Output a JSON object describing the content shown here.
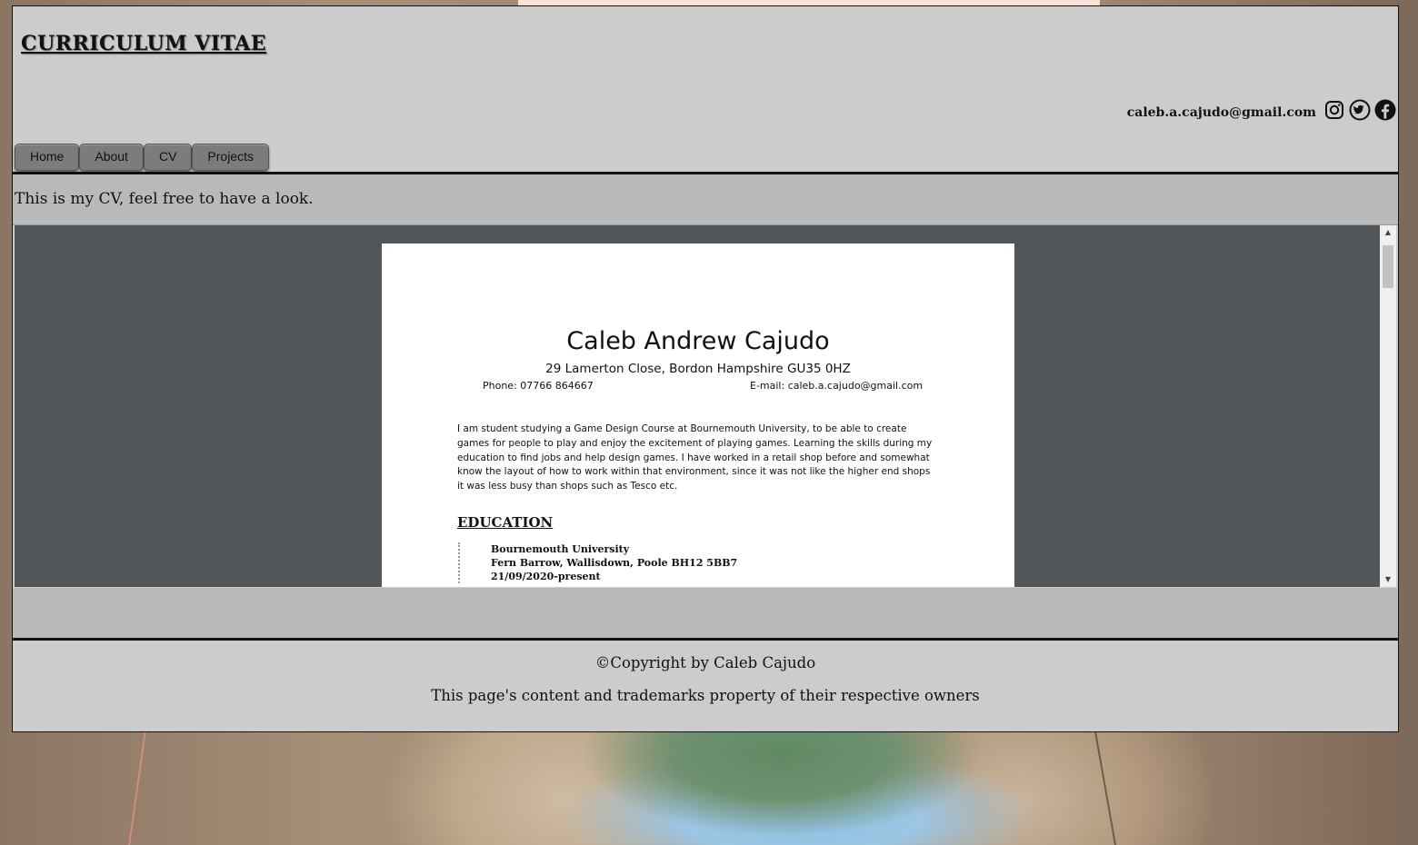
{
  "header": {
    "title": "CURRICULUM VITAE",
    "email": "caleb.a.cajudo@gmail.com",
    "social": [
      "instagram-icon",
      "twitter-icon",
      "facebook-icon"
    ]
  },
  "nav": {
    "items": [
      "Home",
      "About",
      "CV",
      "Projects"
    ]
  },
  "intro": {
    "text": "This is my CV, feel free to have a look."
  },
  "cv": {
    "name": "Caleb Andrew Cajudo",
    "address": "29 Lamerton Close, Bordon Hampshire GU35 0HZ",
    "phone": "Phone: 07766 864667",
    "email": "E-mail: caleb.a.cajudo@gmail.com",
    "summary": "I am student studying a Game Design Course at Bournemouth University, to be able to create games for people to play and enjoy the excitement of playing games. Learning the skills during my education to find jobs and help design games. I have worked in a retail shop before and somewhat know the layout of how to work within that environment, since it was not like the higher end shops it was less busy than shops such as Tesco etc.",
    "education_heading": "EDUCATION",
    "education": {
      "school": "Bournemouth University",
      "address": "Fern Barrow, Wallisdown, Poole BH12 5BB7",
      "dates": "21/09/2020-present"
    }
  },
  "footer": {
    "copyright": "©Copyright by Caleb Cajudo",
    "note": "This page's content and trademarks property of their respective owners"
  }
}
